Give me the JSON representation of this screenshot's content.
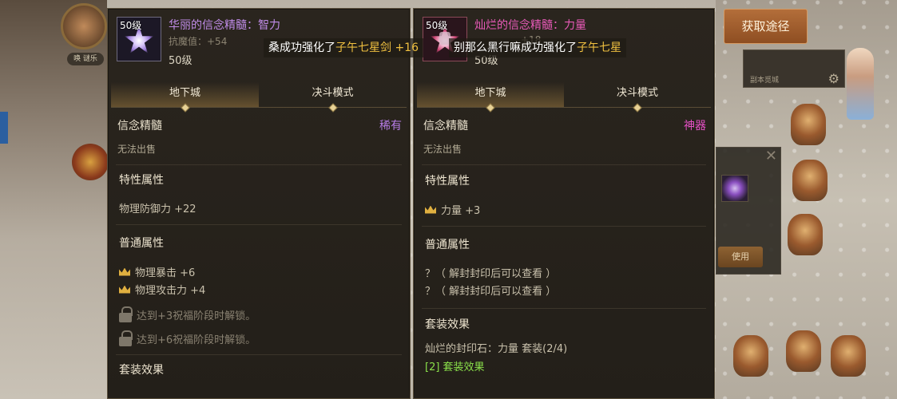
{
  "broadcasts": [
    {
      "prefix": "桑成功强化了",
      "item": "子午七星剑",
      "suffix": " +16"
    },
    {
      "prefix": "别那么黑行嘛成功强化了",
      "item": "子午七星",
      "suffix": ""
    }
  ],
  "get_button": "获取途径",
  "tabs": [
    "地下城",
    "决斗模式"
  ],
  "left_item": {
    "icon": "star-crystal-icon",
    "level_badge": "50级",
    "name": "华丽的信念精髓：智力",
    "sub": "抗魔值：+54",
    "level": "50级",
    "type": "信念精髓",
    "rarity": "稀有",
    "rarity_color": "#b77ce6",
    "trade": "无法出售",
    "special_title": "特性属性",
    "special_attrs": [
      "物理防御力 +22"
    ],
    "normal_title": "普通属性",
    "normal_attrs": [
      "物理暴击 +6",
      "物理攻击力 +4"
    ],
    "locked_attrs": [
      "达到+3祝福阶段时解锁。",
      "达到+6祝福阶段时解锁。"
    ],
    "set_title": "套装效果"
  },
  "right_item": {
    "icon": "seal-stone-icon",
    "level_badge": "50级",
    "name": "灿烂的信念精髓：力量",
    "sub": "+18",
    "level": "50级",
    "type": "信念精髓",
    "rarity": "神器",
    "rarity_color": "#e650c6",
    "trade": "无法出售",
    "special_title": "特性属性",
    "special_attrs": [
      "力量 +3"
    ],
    "normal_title": "普通属性",
    "normal_attrs": [
      "？（ 解封封印后可以查看 ）",
      "？（ 解封封印后可以查看 ）"
    ],
    "set_title": "套装效果",
    "set_name": "灿烂的封印石：力量  套装(2/4)",
    "set_effect": "[2] 套装效果"
  },
  "background": {
    "level_chip": "唤 谜乐",
    "quest_card": "副本觅城",
    "side_use": "使用"
  }
}
